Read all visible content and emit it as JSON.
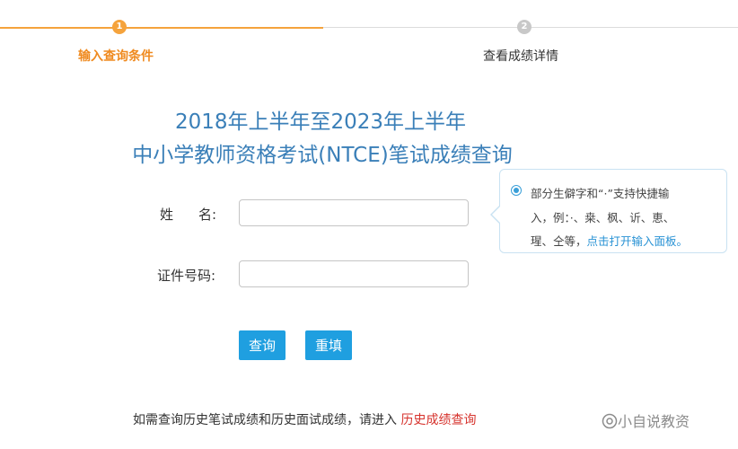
{
  "steps": [
    {
      "number": "1",
      "label": "输入查询条件",
      "active": true
    },
    {
      "number": "2",
      "label": "查看成绩详情",
      "active": false
    }
  ],
  "colors": {
    "accent_orange": "#f5a33c",
    "title_blue": "#3a7fb8",
    "button_blue": "#1f9fe0",
    "link_red": "#d6322c",
    "tip_link_blue": "#2a93d5"
  },
  "title": {
    "line1": "2018年上半年至2023年上半年",
    "line2": "中小学教师资格考试(NTCE)笔试成绩查询"
  },
  "form": {
    "name_label_first": "姓",
    "name_label_last": "名:",
    "name_value": "",
    "id_label": "证件号码:",
    "id_value": ""
  },
  "tooltip": {
    "line1": "部分生僻字和“·”支持快捷输",
    "line2": "入，例：·、桒、枫、䜣、恵、",
    "line3_prefix": "瑆、仝等，",
    "line3_link": "点击打开输入面板。"
  },
  "buttons": {
    "query": "查询",
    "reset": "重填"
  },
  "footer": {
    "note": "如需查询历史笔试成绩和历史面试成绩，请进入 ",
    "link": "历史成绩查询"
  },
  "watermark": {
    "text": "小自说教资"
  }
}
